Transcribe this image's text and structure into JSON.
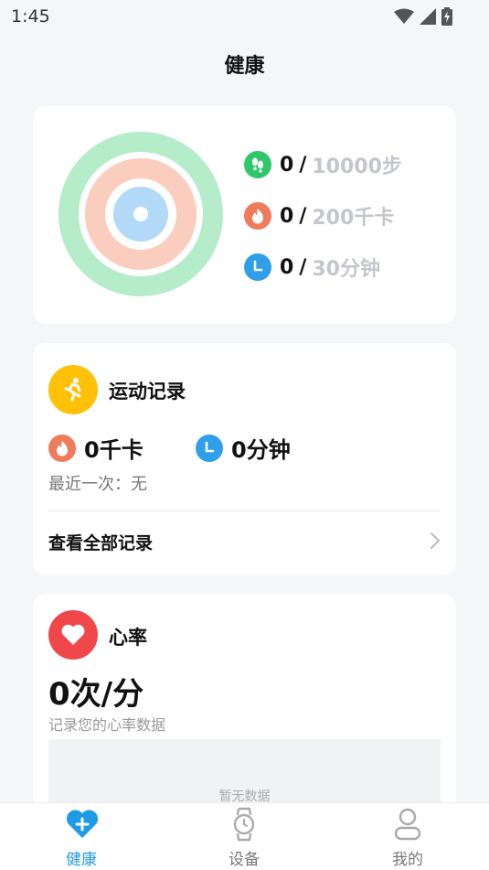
{
  "status_bar": {
    "time": "1:45"
  },
  "page": {
    "title": "健康"
  },
  "daily_goals": {
    "steps": {
      "value": "0",
      "separator": "/",
      "goal": "10000步"
    },
    "calories": {
      "value": "0",
      "separator": "/",
      "goal": "200千卡"
    },
    "duration": {
      "value": "0",
      "separator": "/",
      "goal": "30分钟"
    },
    "colors": {
      "steps": "#2ec76c",
      "calories": "#f07b5a",
      "duration": "#2e9fe8"
    }
  },
  "exercise_card": {
    "title": "运动记录",
    "calories": "0千卡",
    "duration": "0分钟",
    "last_time": "最近一次：无",
    "view_all": "查看全部记录",
    "accent": "#ffc107"
  },
  "heart_card": {
    "title": "心率",
    "value": "0次/分",
    "subtitle": "记录您的心率数据",
    "empty": "暂无数据",
    "accent": "#f0474a"
  },
  "tab_bar": {
    "tabs": [
      {
        "label": "健康",
        "icon": "heart-plus-icon",
        "active": true
      },
      {
        "label": "设备",
        "icon": "watch-icon",
        "active": false
      },
      {
        "label": "我的",
        "icon": "person-icon",
        "active": false
      }
    ],
    "active_color": "#1e9be8"
  }
}
